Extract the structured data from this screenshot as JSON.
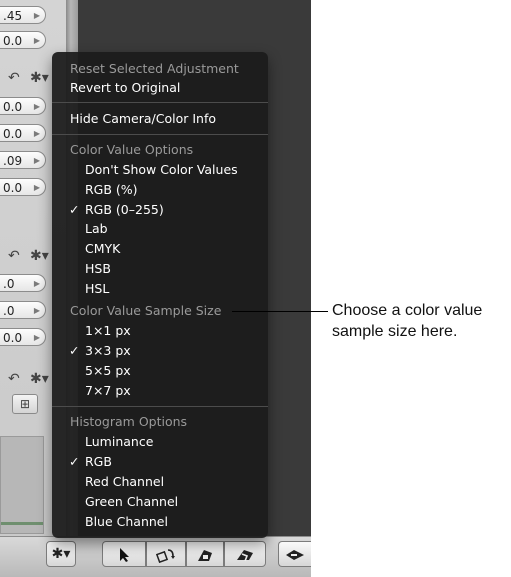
{
  "left_panel": {
    "fields_top": [
      ".45",
      "0.0"
    ],
    "fields_group1": [
      "0.0",
      "0.0",
      ".09",
      "0.0"
    ],
    "fields_group2": [
      ".0",
      ".0",
      "0.0"
    ],
    "undo_icon": "undo-arrow",
    "gear_icon": "gear",
    "field_arrow": "▶",
    "fit_button_icon": "⊞"
  },
  "menu": {
    "reset_label": "Reset Selected Adjustment",
    "revert_label": "Revert to Original",
    "hide_info_label": "Hide Camera/Color Info",
    "color_value_header": "Color Value Options",
    "color_value_items": [
      {
        "label": "Don't Show Color Values",
        "checked": false
      },
      {
        "label": "RGB (%)",
        "checked": false
      },
      {
        "label": "RGB (0–255)",
        "checked": true
      },
      {
        "label": "Lab",
        "checked": false
      },
      {
        "label": "CMYK",
        "checked": false
      },
      {
        "label": "HSB",
        "checked": false
      },
      {
        "label": "HSL",
        "checked": false
      }
    ],
    "sample_size_header": "Color Value Sample Size",
    "sample_size_items": [
      {
        "label": "1×1 px",
        "checked": false
      },
      {
        "label": "3×3 px",
        "checked": true
      },
      {
        "label": "5×5 px",
        "checked": false
      },
      {
        "label": "7×7 px",
        "checked": false
      }
    ],
    "histogram_header": "Histogram Options",
    "histogram_items": [
      {
        "label": "Luminance",
        "checked": false
      },
      {
        "label": "RGB",
        "checked": true
      },
      {
        "label": "Red Channel",
        "checked": false
      },
      {
        "label": "Green Channel",
        "checked": false
      },
      {
        "label": "Blue Channel",
        "checked": false
      }
    ],
    "check_glyph": "✓"
  },
  "callout": {
    "text": "Choose a color value sample size here."
  },
  "toolbar": {
    "gear_icon": "gear",
    "tools": [
      "pointer-arrow",
      "rotate-tool",
      "straighten-tool",
      "crop-tool",
      "expand-tool"
    ]
  }
}
